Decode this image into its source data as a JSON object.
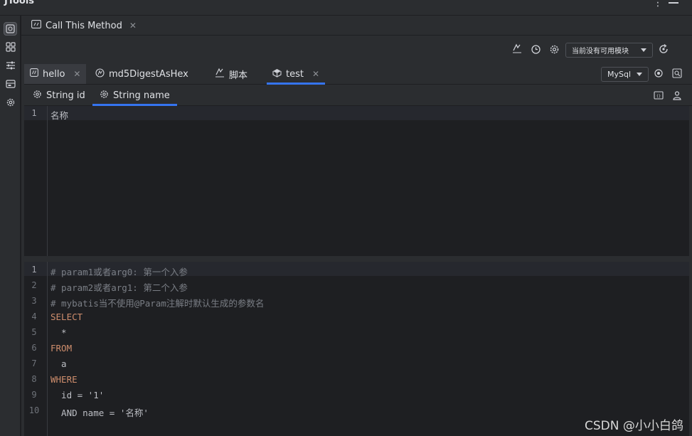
{
  "app": {
    "title": "JTools"
  },
  "leftbar": {
    "icons": [
      "call-method-icon",
      "plugins-grid-icon",
      "settings-sliders-icon",
      "storage-icon",
      "gear-icon"
    ]
  },
  "toolwindow": {
    "tab_label": "Call This Method"
  },
  "actions": {
    "module_select_value": "当前没有可用模块"
  },
  "method_tabs": [
    {
      "label": "hello",
      "closable": true
    },
    {
      "label": "md5DigestAsHex",
      "closable": false
    },
    {
      "label": "脚本",
      "closable": false
    },
    {
      "label": "test",
      "closable": true
    }
  ],
  "db_select_value": "MySql",
  "param_tabs": [
    {
      "label": "String id"
    },
    {
      "label": "String name"
    }
  ],
  "param_editor": {
    "lines": [
      {
        "num": "1",
        "text": "名称"
      }
    ]
  },
  "sql_editor": {
    "lines": [
      {
        "num": "1",
        "text": "# param1或者arg0: 第一个入参"
      },
      {
        "num": "2",
        "text": "# param2或者arg1: 第二个入参"
      },
      {
        "num": "3",
        "text": "# mybatis当不使用@Param注解时默认生成的参数名"
      },
      {
        "num": "4",
        "text": "SELECT"
      },
      {
        "num": "5",
        "text": "  *"
      },
      {
        "num": "6",
        "text": "FROM"
      },
      {
        "num": "7",
        "text": "  a"
      },
      {
        "num": "8",
        "text": "WHERE"
      },
      {
        "num": "9",
        "text": "  id = '1'"
      },
      {
        "num": "10",
        "text": "  AND name = '名称'"
      }
    ]
  },
  "watermark": "CSDN @小小白鸽",
  "colors": {
    "accent": "#3574f0",
    "background": "#1e1f22",
    "panel": "#2b2d30",
    "keyword": "#cf8e6d",
    "string": "#6aab73",
    "comment": "#7a7e85"
  }
}
